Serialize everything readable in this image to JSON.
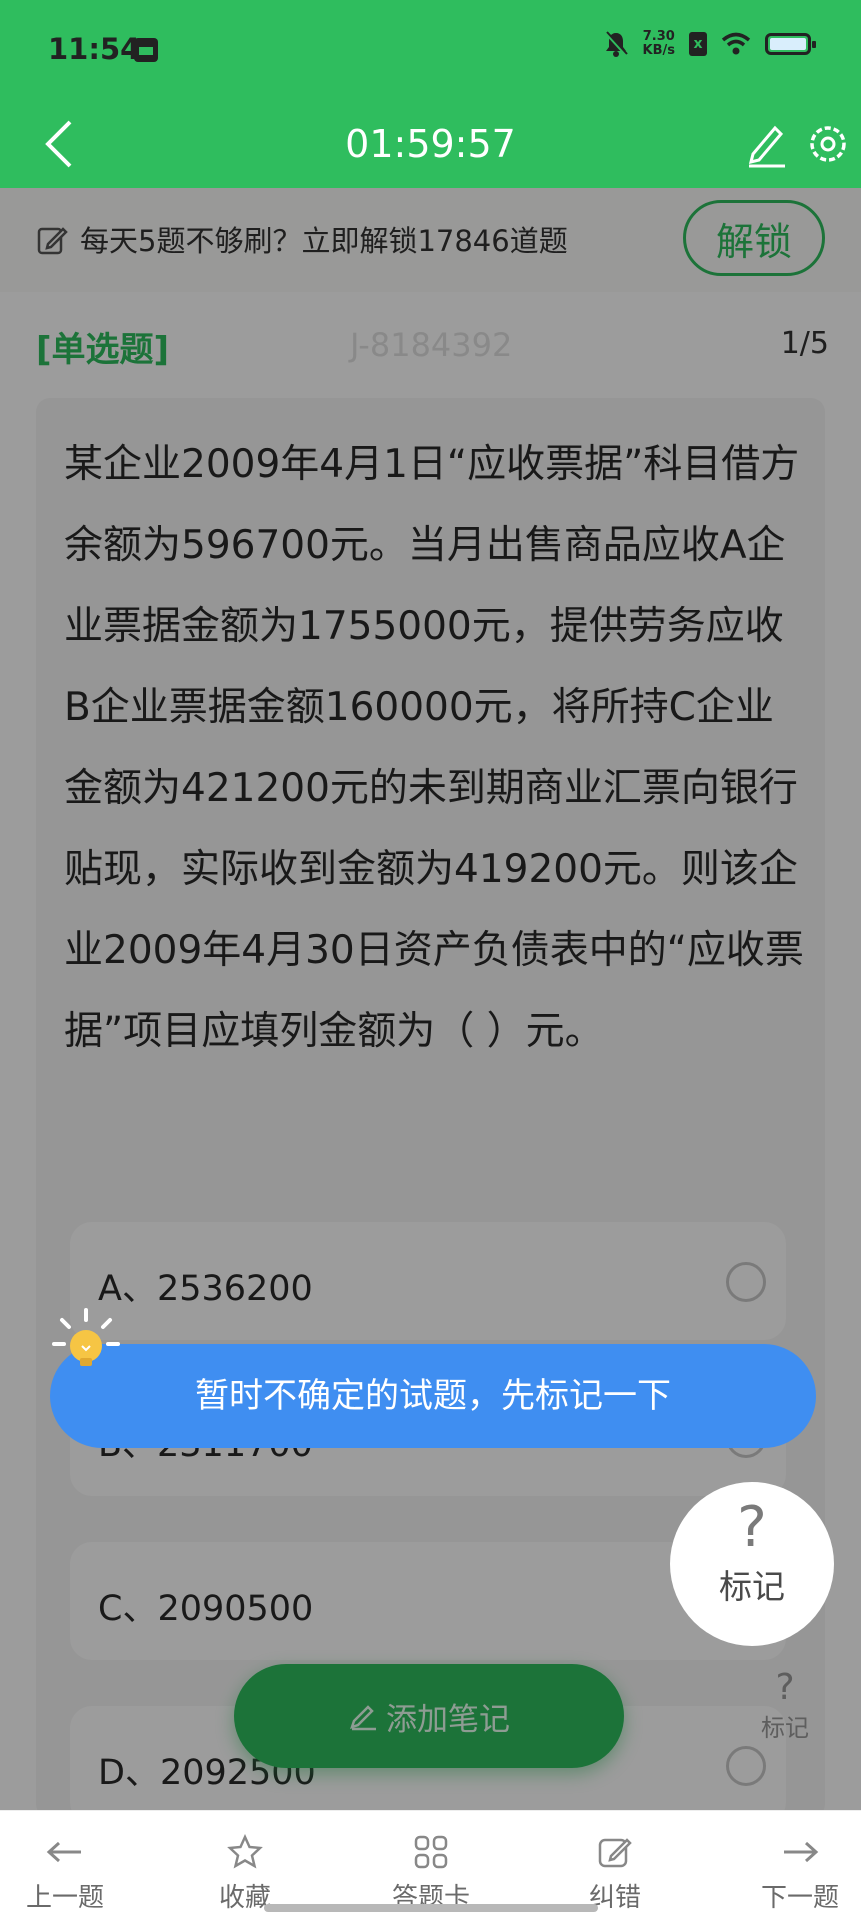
{
  "status_bar": {
    "time": "11:54",
    "speed_top": "7.30",
    "speed_bottom": "KB/s",
    "sim": "x"
  },
  "header": {
    "timer": "01:59:57",
    "background": "#2fbd5e"
  },
  "banner": {
    "text": "每天5题不够刷？立即解锁17846道题",
    "unlock_label": "解锁"
  },
  "question": {
    "type": "[单选题]",
    "id": "J-8184392",
    "progress": "1/5",
    "text": "某企业2009年4月1日“应收票据”科目借方余额为596700元。当月出售商品应收A企业票据金额为1755000元，提供劳务应收B企业票据金额160000元，将所持C企业金额为421200元的未到期商业汇票向银行贴现，实际收到金额为419200元。则该企业2009年4月30日资产负债表中的“应收票据”项目应填列金额为（ ）元。",
    "options": [
      {
        "label": "A、2536200"
      },
      {
        "label": "B、2311700"
      },
      {
        "label": "C、2090500"
      },
      {
        "label": "D、2092500"
      }
    ]
  },
  "mark": {
    "symbol": "?",
    "label": "标记"
  },
  "tooltip": {
    "text": "暂时不确定的试题，先标记一下"
  },
  "note_button": {
    "label": "添加笔记"
  },
  "bottom_nav": {
    "prev": "上一题",
    "favorite": "收藏",
    "answer_card": "答题卡",
    "report_error": "纠错",
    "next": "下一题"
  },
  "colors": {
    "accent": "#2fbd5e",
    "tooltip": "#3f8ef1"
  }
}
